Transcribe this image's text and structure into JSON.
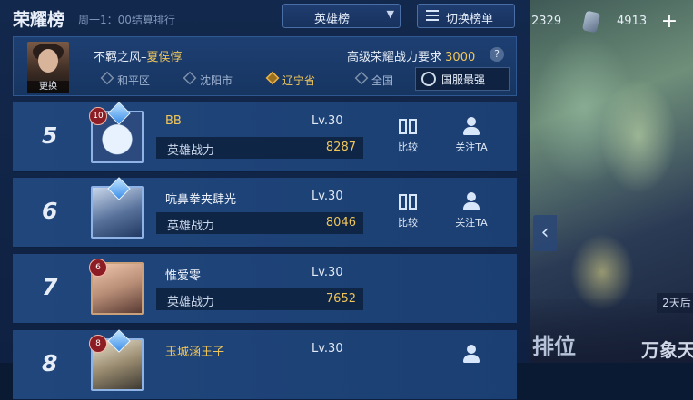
{
  "header": {
    "title": "荣耀榜",
    "subtitle": "周一1：00结算排行",
    "dropdown_label": "英雄榜",
    "switch_label": "切换榜单"
  },
  "resources": {
    "value1": "2329",
    "value2": "4913",
    "plus": "+"
  },
  "side": {
    "arrow": "‹",
    "days_badge": "2天后",
    "rank_label": "排位",
    "wanxiang": "万象天"
  },
  "my_card": {
    "change_label": "更换",
    "hero_prefix": "不羁之风–",
    "hero_name": "夏侯惇",
    "requirement_prefix": "高级荣耀战力要求",
    "requirement_value": "3000",
    "help": "?",
    "regions": [
      {
        "label": "和平区",
        "active": false
      },
      {
        "label": "沈阳市",
        "active": false
      },
      {
        "label": "辽宁省",
        "active": true
      },
      {
        "label": "全国",
        "active": false
      }
    ],
    "national_button": "国服最强"
  },
  "rows": [
    {
      "rank": "5",
      "level_badge": "10",
      "name": "BB",
      "name_gold": true,
      "lv": "Lv.30",
      "power_label": "英雄战力",
      "power": "8287"
    },
    {
      "rank": "6",
      "level_badge": "",
      "name": "吭鼻拳夹肆光",
      "name_gold": false,
      "lv": "Lv.30",
      "power_label": "英雄战力",
      "power": "8046"
    },
    {
      "rank": "7",
      "level_badge": "6",
      "name": "惟爱零",
      "name_gold": false,
      "lv": "Lv.30",
      "power_label": "英雄战力",
      "power": "7652"
    },
    {
      "rank": "8",
      "level_badge": "8",
      "name": "玉城涵王子",
      "name_gold": true,
      "lv": "Lv.30",
      "power_label": "英雄战力",
      "power": ""
    }
  ],
  "actions": {
    "compare": "比较",
    "follow": "关注TA"
  },
  "colors": {
    "gold": "#f0c65a",
    "panel": "#12284c",
    "row": "#20467c"
  }
}
